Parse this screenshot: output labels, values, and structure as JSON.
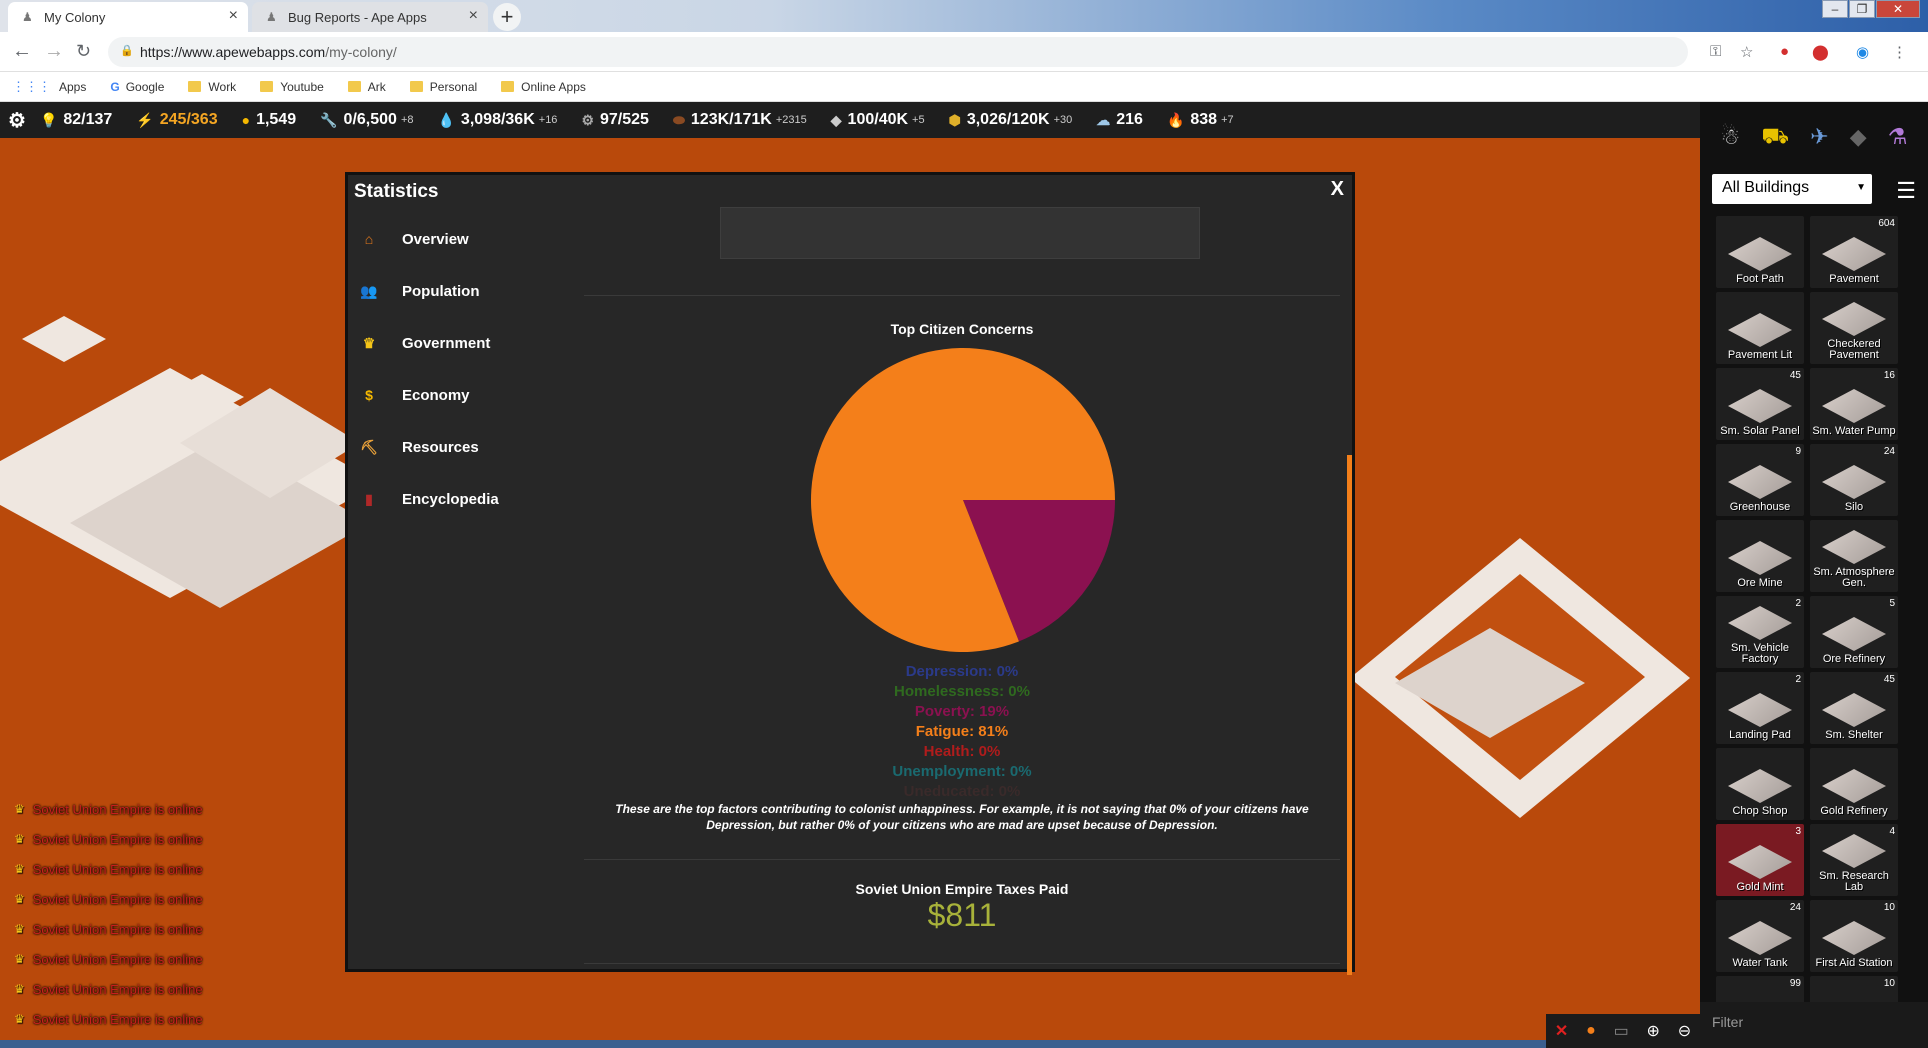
{
  "browser": {
    "tabs": [
      {
        "title": "My Colony",
        "active": true
      },
      {
        "title": "Bug Reports - Ape Apps",
        "active": false
      }
    ],
    "url_host": "https://www.apewebapps.com",
    "url_path": "/my-colony/",
    "bookmarks": [
      "Apps",
      "Google",
      "Work",
      "Youtube",
      "Ark",
      "Personal",
      "Online Apps"
    ]
  },
  "resources": [
    {
      "icon": "lightbulb-icon",
      "value": "82/137",
      "rate": "",
      "color": "#ffffff"
    },
    {
      "icon": "lightning-icon",
      "value": "245/363",
      "rate": "",
      "color": "#f5a623"
    },
    {
      "icon": "coin-icon",
      "value": "1,549",
      "rate": "",
      "color": "#ffffff"
    },
    {
      "icon": "wrench-icon",
      "value": "0/6,500",
      "rate": "+8",
      "color": "#ffffff"
    },
    {
      "icon": "water-drop-icon",
      "value": "3,098/36K",
      "rate": "+16",
      "color": "#ffffff"
    },
    {
      "icon": "gear-resource-icon",
      "value": "97/525",
      "rate": "",
      "color": "#ffffff"
    },
    {
      "icon": "ore-icon",
      "value": "123K/171K",
      "rate": "+2315",
      "color": "#ffffff"
    },
    {
      "icon": "aluminum-icon",
      "value": "100/40K",
      "rate": "+5",
      "color": "#ffffff"
    },
    {
      "icon": "gold-ore-icon",
      "value": "3,026/120K",
      "rate": "+30",
      "color": "#ffffff"
    },
    {
      "icon": "food-icon",
      "value": "216",
      "rate": "",
      "color": "#ffffff"
    },
    {
      "icon": "fire-icon",
      "value": "838",
      "rate": "+7",
      "color": "#ffffff"
    }
  ],
  "statistics": {
    "title": "Statistics",
    "close": "X",
    "nav": [
      {
        "label": "Overview",
        "icon": "house-icon",
        "color": "#e87a1a"
      },
      {
        "label": "Population",
        "icon": "people-icon",
        "color": "#dddddd"
      },
      {
        "label": "Government",
        "icon": "crown-icon",
        "color": "#f5c518"
      },
      {
        "label": "Economy",
        "icon": "coin-icon",
        "color": "#f5b800"
      },
      {
        "label": "Resources",
        "icon": "resources-icon",
        "color": "#e8a13a"
      },
      {
        "label": "Encyclopedia",
        "icon": "book-icon",
        "color": "#b02828"
      }
    ],
    "chart_data": {
      "type": "pie",
      "title": "Top Citizen Concerns",
      "slices": [
        {
          "name": "Depression",
          "label": "Depression: 0%",
          "value": 0,
          "color": "#2b3a8a"
        },
        {
          "name": "Homelessness",
          "label": "Homelessness: 0%",
          "value": 0,
          "color": "#2f6a1f"
        },
        {
          "name": "Poverty",
          "label": "Poverty: 19%",
          "value": 19,
          "color": "#8b1150"
        },
        {
          "name": "Fatigue",
          "label": "Fatigue: 81%",
          "value": 81,
          "color": "#f47f1a"
        },
        {
          "name": "Health",
          "label": "Health: 0%",
          "value": 0,
          "color": "#b01c1c"
        },
        {
          "name": "Unemployment",
          "label": "Unemployment: 0%",
          "value": 0,
          "color": "#1a6a70"
        },
        {
          "name": "Uneducated",
          "label": "Uneducated: 0%",
          "value": 0,
          "color": "#3a2a2a"
        }
      ]
    },
    "note": "These are the top factors contributing to colonist unhappiness. For example, it is not saying that 0% of your citizens have Depression, but rather 0% of your citizens who are mad are upset because of Depression.",
    "taxes_title": "Soviet Union Empire Taxes Paid",
    "taxes_value": "$811"
  },
  "chat": [
    "Soviet Union Empire is online",
    "Soviet Union Empire is online",
    "Soviet Union Empire is online",
    "Soviet Union Empire is online",
    "Soviet Union Empire is online",
    "Soviet Union Empire is online",
    "Soviet Union Empire is online",
    "Soviet Union Empire is online"
  ],
  "buildings": {
    "select": "All Buildings",
    "filter_placeholder": "Filter",
    "items": [
      {
        "name": "Foot Path",
        "count": ""
      },
      {
        "name": "Pavement",
        "count": "604"
      },
      {
        "name": "Pavement Lit",
        "count": ""
      },
      {
        "name": "Checkered Pavement",
        "count": ""
      },
      {
        "name": "Sm. Solar Panel",
        "count": "45"
      },
      {
        "name": "Sm. Water Pump",
        "count": "16"
      },
      {
        "name": "Greenhouse",
        "count": "9"
      },
      {
        "name": "Silo",
        "count": "24"
      },
      {
        "name": "Ore Mine",
        "count": ""
      },
      {
        "name": "Sm. Atmosphere Gen.",
        "count": ""
      },
      {
        "name": "Sm. Vehicle Factory",
        "count": "2"
      },
      {
        "name": "Ore Refinery",
        "count": "5"
      },
      {
        "name": "Landing Pad",
        "count": "2"
      },
      {
        "name": "Sm. Shelter",
        "count": "45"
      },
      {
        "name": "Chop Shop",
        "count": ""
      },
      {
        "name": "Gold Refinery",
        "count": ""
      },
      {
        "name": "Gold Mint",
        "count": "3",
        "selected": true
      },
      {
        "name": "Sm. Research Lab",
        "count": "4"
      },
      {
        "name": "Water Tank",
        "count": "24"
      },
      {
        "name": "First Aid Station",
        "count": "10"
      },
      {
        "name": "",
        "count": "99"
      },
      {
        "name": "",
        "count": "10"
      }
    ]
  }
}
